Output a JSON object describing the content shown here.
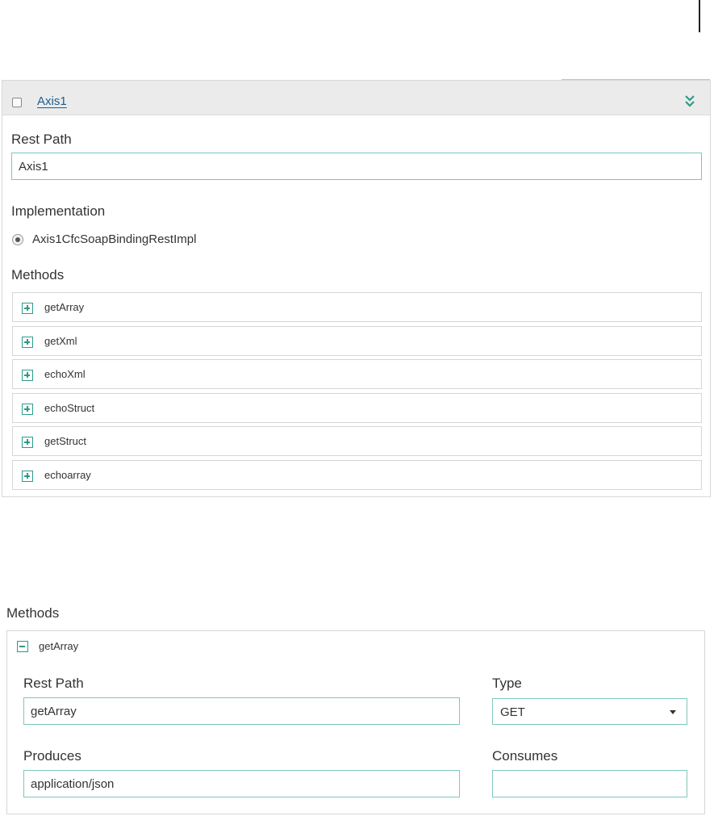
{
  "service": {
    "name": "Axis1",
    "rest_path_label": "Rest Path",
    "rest_path_value": "Axis1",
    "implementation_label": "Implementation",
    "implementation_option": "Axis1CfcSoapBindingRestImpl",
    "methods_label": "Methods",
    "methods": [
      {
        "name": "getArray"
      },
      {
        "name": "getXml"
      },
      {
        "name": "echoXml"
      },
      {
        "name": "echoStruct"
      },
      {
        "name": "getStruct"
      },
      {
        "name": "echoarray"
      }
    ]
  },
  "method_detail": {
    "methods_label": "Methods",
    "name": "getArray",
    "rest_path_label": "Rest Path",
    "rest_path_value": "getArray",
    "type_label": "Type",
    "type_value": "GET",
    "produces_label": "Produces",
    "produces_value": "application/json",
    "consumes_label": "Consumes",
    "consumes_value": ""
  },
  "colors": {
    "accent_teal": "#2f9a8a",
    "input_border": "#7ec6bd",
    "link": "#1d5e8c"
  }
}
